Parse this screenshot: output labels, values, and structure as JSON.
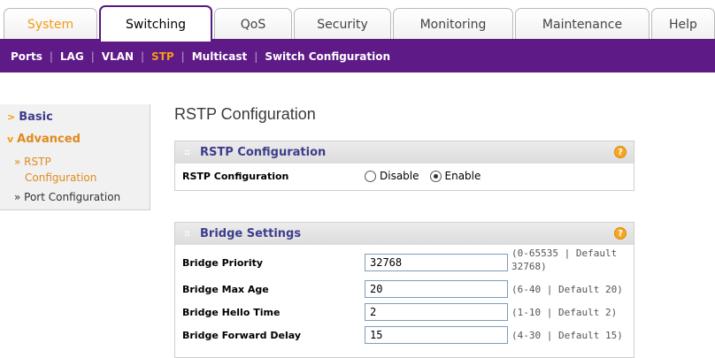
{
  "tabs": [
    {
      "label": "System",
      "state": "orange"
    },
    {
      "label": "Switching",
      "state": "active"
    },
    {
      "label": "QoS",
      "state": ""
    },
    {
      "label": "Security",
      "state": ""
    },
    {
      "label": "Monitoring",
      "state": ""
    },
    {
      "label": "Maintenance",
      "state": ""
    },
    {
      "label": "Help",
      "state": ""
    }
  ],
  "subnav": {
    "items": [
      "Ports",
      "LAG",
      "VLAN",
      "STP",
      "Multicast",
      "Switch Configuration"
    ],
    "active": "STP"
  },
  "sidebar": {
    "basic": "Basic",
    "advanced": "Advanced",
    "rstp_line1": "» RSTP",
    "rstp_line2": "Configuration",
    "port_config": "» Port Configuration"
  },
  "page_title": "RSTP Configuration",
  "rstp_panel": {
    "title": "RSTP Configuration",
    "help": "?",
    "field_label": "RSTP Configuration",
    "opt_disable": "Disable",
    "opt_enable": "Enable",
    "selected": "Enable"
  },
  "bridge_panel": {
    "title": "Bridge Settings",
    "help": "?",
    "rows": [
      {
        "label": "Bridge Priority",
        "value": "32768",
        "hint_1": "(0-65535 | Default",
        "hint_2": "32768)"
      },
      {
        "label": "Bridge Max Age",
        "value": "20",
        "hint_1": "(6-40 | Default 20)",
        "hint_2": ""
      },
      {
        "label": "Bridge Hello Time",
        "value": "2",
        "hint_1": "(1-10 | Default 2)",
        "hint_2": ""
      },
      {
        "label": "Bridge Forward Delay",
        "value": "15",
        "hint_1": "(4-30 | Default 15)",
        "hint_2": ""
      }
    ]
  },
  "colors": {
    "nav_purple": "#5e1a86",
    "accent_orange": "#f39c12",
    "header_blue": "#3d3d8c"
  }
}
